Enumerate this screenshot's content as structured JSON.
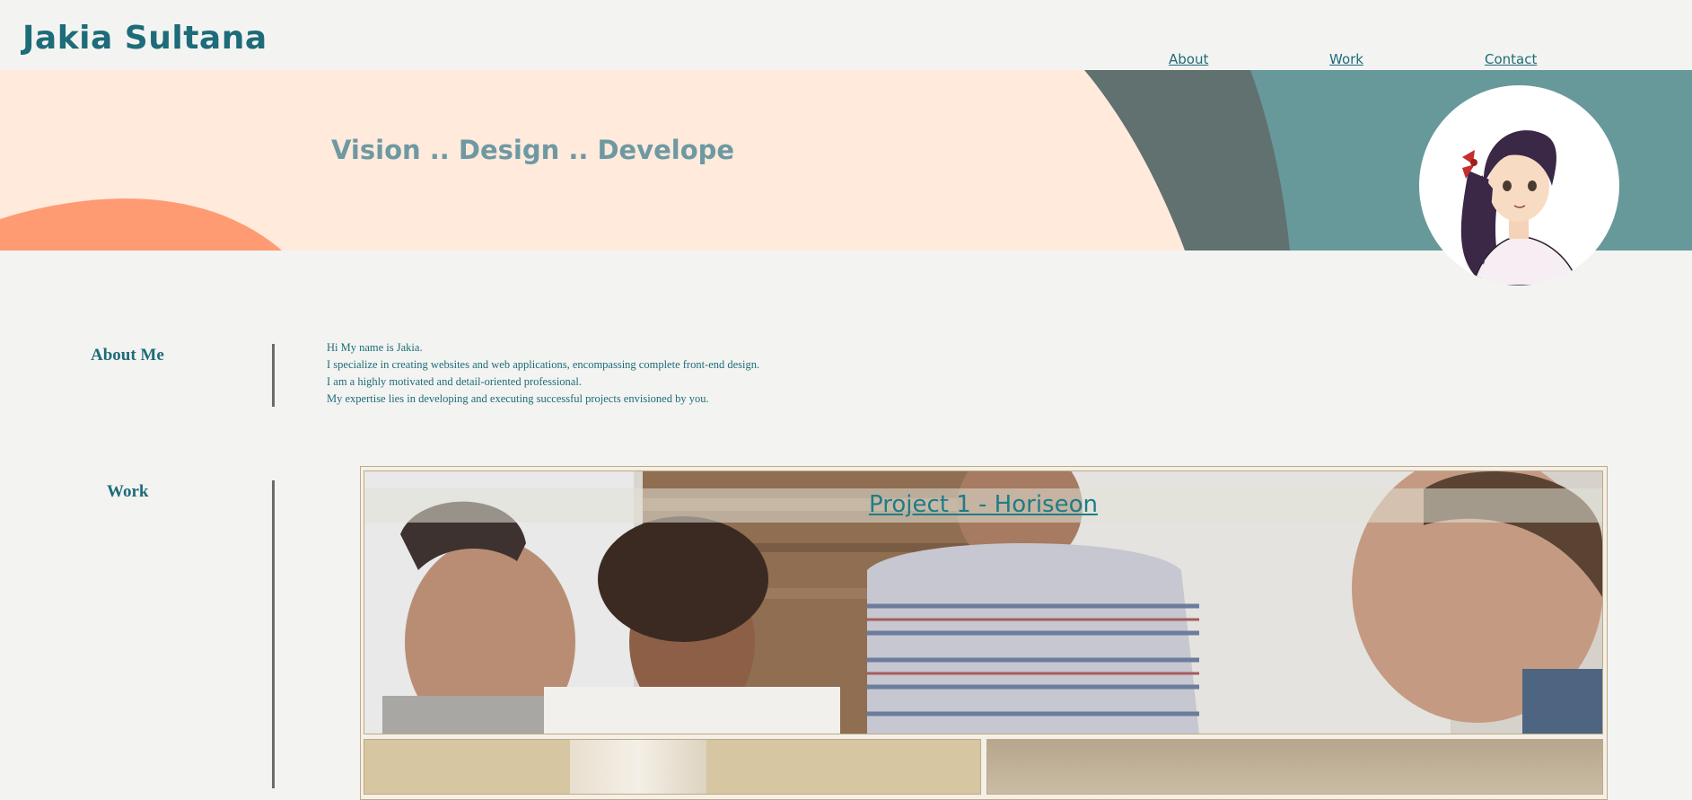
{
  "header": {
    "title": "Jakia Sultana",
    "nav": [
      {
        "label": "About"
      },
      {
        "label": "Work"
      },
      {
        "label": "Contact"
      }
    ]
  },
  "hero": {
    "tagline": "Vision .. Design .. Develope",
    "colors": {
      "peach": "#ffeadc",
      "coral": "#ff9b73",
      "slate": "#607170",
      "teal": "#67999b"
    }
  },
  "about": {
    "label": "About Me",
    "lines": [
      "Hi My name is Jakia.",
      "I specialize in creating websites and web applications, encompassing complete front-end design.",
      "I am a highly motivated and detail-oriented professional.",
      "My expertise lies in developing and executing successful projects envisioned by you."
    ]
  },
  "work": {
    "label": "Work",
    "projects": [
      {
        "title": "Project 1 - Horiseon"
      }
    ]
  },
  "colors": {
    "accent": "#1e6b7a",
    "background": "#f3f4f1"
  }
}
